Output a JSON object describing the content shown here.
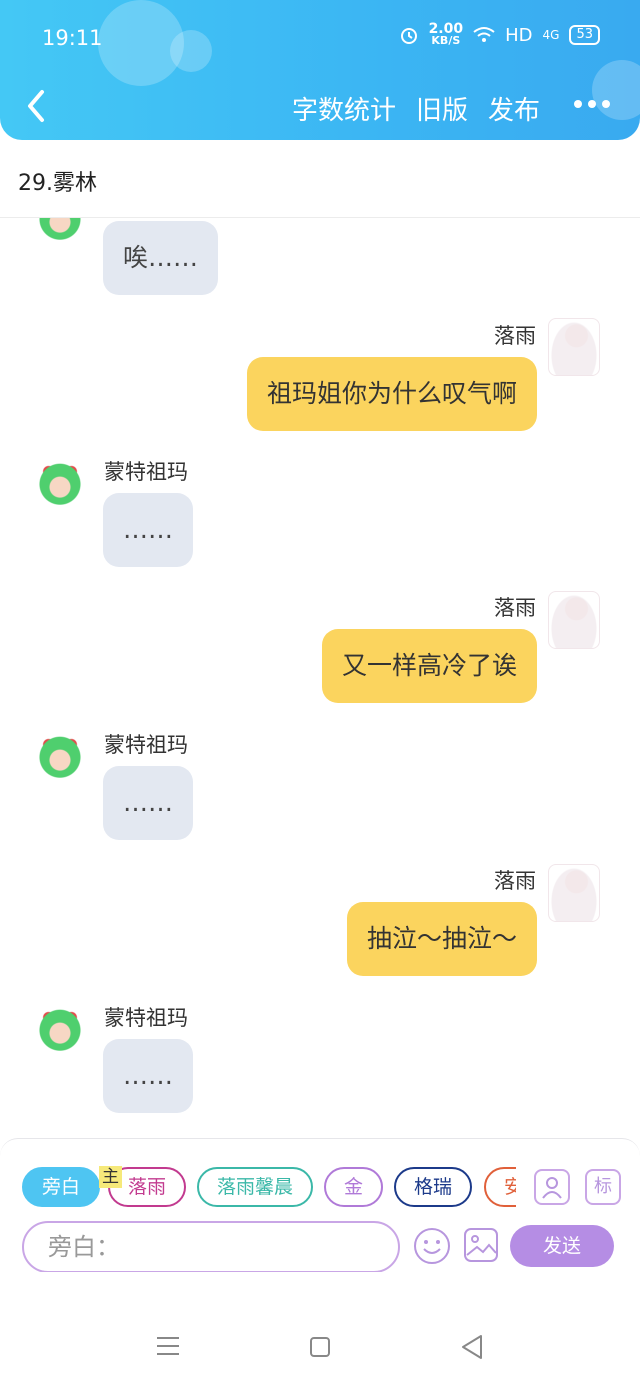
{
  "status_bar": {
    "time": "19:11",
    "speed_value": "2.00",
    "speed_unit": "KB/S",
    "network": "HD",
    "signal": "4G",
    "battery": "53"
  },
  "header": {
    "actions": [
      "字数统计",
      "旧版",
      "发布"
    ],
    "background": "#3bb5f3"
  },
  "chapter": {
    "title": "29.雾林"
  },
  "messages": [
    {
      "side": "left",
      "name": "",
      "text": "唉……"
    },
    {
      "side": "right",
      "name": "落雨",
      "text": "祖玛姐你为什么叹气啊"
    },
    {
      "side": "left",
      "name": "蒙特祖玛",
      "text": "……"
    },
    {
      "side": "right",
      "name": "落雨",
      "text": "又一样高冷了诶"
    },
    {
      "side": "left",
      "name": "蒙特祖玛",
      "text": "……"
    },
    {
      "side": "right",
      "name": "落雨",
      "text": "抽泣～抽泣～"
    },
    {
      "side": "left",
      "name": "蒙特祖玛",
      "text": "……"
    }
  ],
  "composer": {
    "chips": [
      {
        "label": "旁白",
        "color": "#4ec5f2",
        "active": true
      },
      {
        "label": "落雨",
        "color": "#c23a8f",
        "active": false
      },
      {
        "label": "落雨馨晨",
        "color": "#3bb8a8",
        "active": false
      },
      {
        "label": "金",
        "color": "#b07ad8",
        "active": false
      },
      {
        "label": "格瑞",
        "color": "#1c3a8a",
        "active": false
      },
      {
        "label": "安",
        "color": "#e0603a",
        "active": false
      }
    ],
    "host_badge": "主",
    "tag_button": "标",
    "input_placeholder": "旁白：",
    "send_label": "发送",
    "accent": "#b58de4"
  }
}
